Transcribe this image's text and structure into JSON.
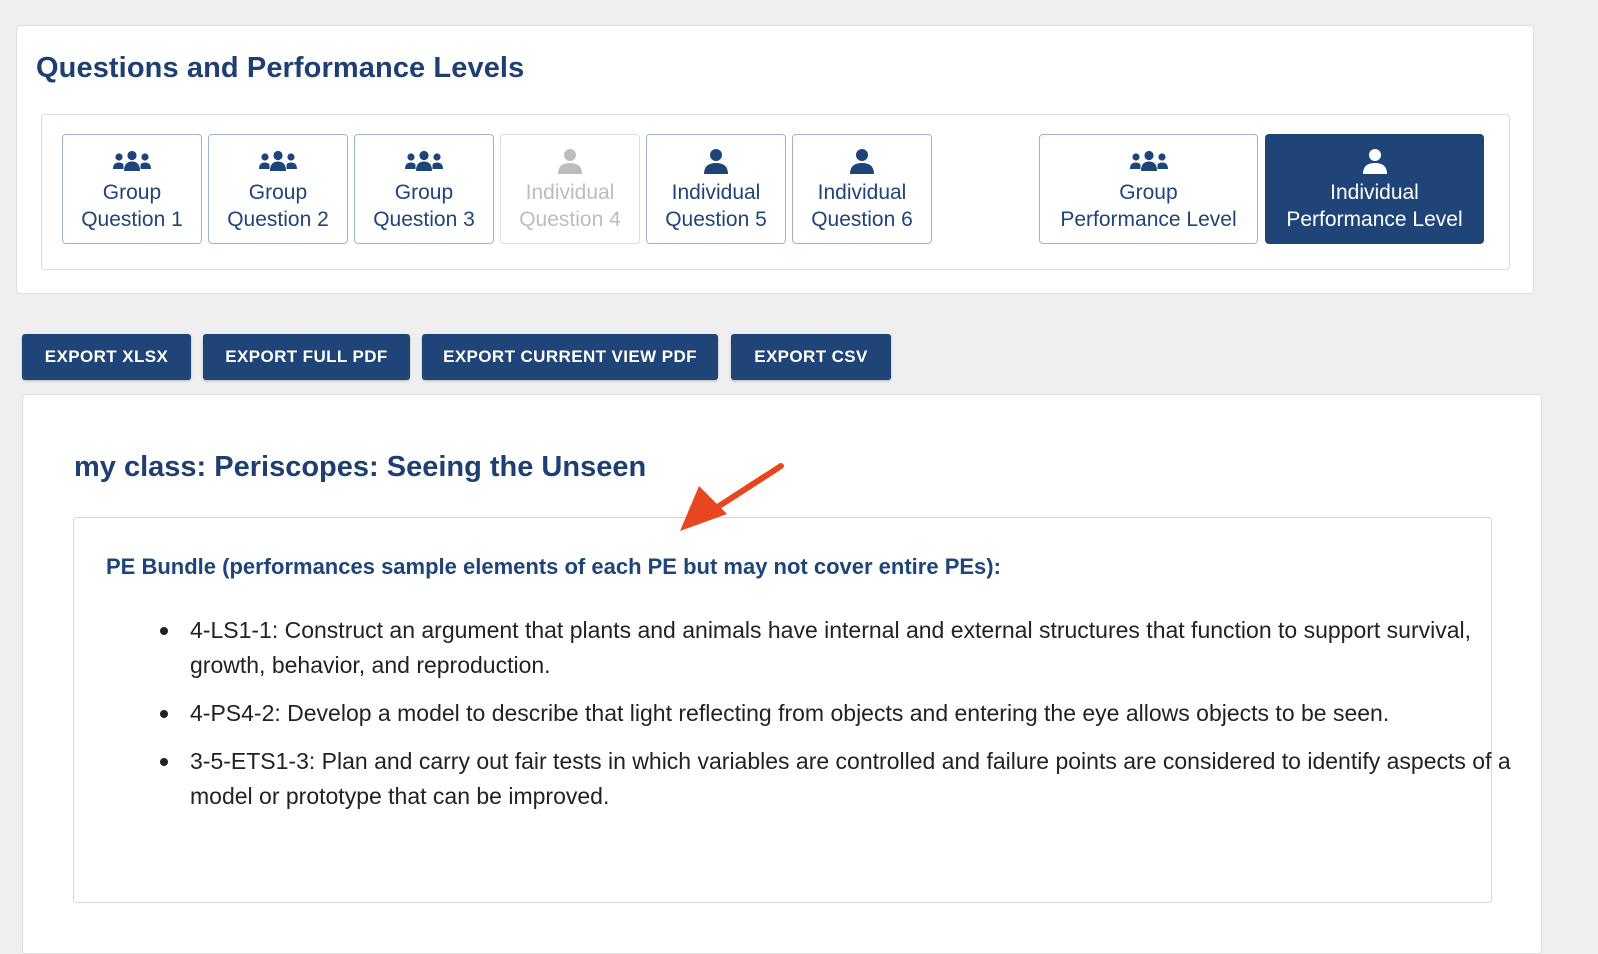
{
  "panel": {
    "title": "Questions and Performance Levels",
    "tabs": [
      {
        "line1": "Group",
        "line2": "Question 1",
        "icon": "group-icon",
        "state": "normal"
      },
      {
        "line1": "Group",
        "line2": "Question 2",
        "icon": "group-icon",
        "state": "normal"
      },
      {
        "line1": "Group",
        "line2": "Question 3",
        "icon": "group-icon",
        "state": "normal"
      },
      {
        "line1": "Individual",
        "line2": "Question 4",
        "icon": "person-icon",
        "state": "disabled"
      },
      {
        "line1": "Individual",
        "line2": "Question 5",
        "icon": "person-icon",
        "state": "normal"
      },
      {
        "line1": "Individual",
        "line2": "Question 6",
        "icon": "person-icon",
        "state": "normal"
      },
      {
        "line1": "Group",
        "line2": "Performance Level",
        "icon": "group-icon",
        "state": "normal"
      },
      {
        "line1": "Individual",
        "line2": "Performance Level",
        "icon": "person-icon",
        "state": "active"
      }
    ]
  },
  "toolbar": {
    "export_xlsx": "EXPORT XLSX",
    "export_full_pdf": "EXPORT FULL PDF",
    "export_current_view_pdf": "EXPORT CURRENT VIEW PDF",
    "export_csv": "EXPORT CSV"
  },
  "content": {
    "class_title": "my class: Periscopes: Seeing the Unseen",
    "pe_heading": "PE Bundle (performances sample elements of each PE but may not cover entire PEs):",
    "pe_items": [
      "4-LS1-1: Construct an argument that plants and animals have internal and external structures that function to support survival, growth, behavior, and reproduction.",
      "4-PS4-2: Develop a model to describe that light reflecting from objects and entering the eye allows objects to be seen.",
      "3-5-ETS1-3: Plan and carry out fair tests in which variables are controlled and failure points are considered to identify aspects of a model or prototype that can be improved."
    ]
  },
  "annotation": {
    "icon": "arrow-annotation",
    "color": "#e8461f"
  },
  "colors": {
    "brand": "#1f4477",
    "title": "#1f3f73",
    "disabled": "#bdbdbd",
    "background": "#efefef"
  }
}
